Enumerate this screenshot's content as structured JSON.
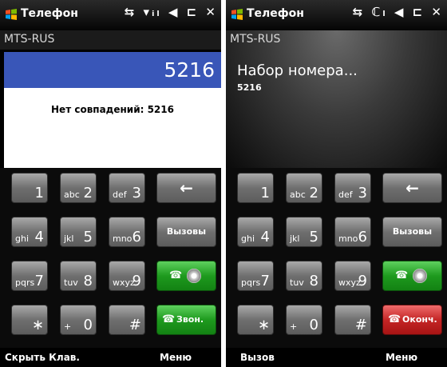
{
  "screen_left": {
    "status_title": "Телефон",
    "status_icons": "⇆ ▾ᵢₗ ◀ ⊏ ✕",
    "carrier": "MTS-RUS",
    "entered_number": "5216",
    "no_matches": "Нет совпадений: 5216",
    "keys": [
      {
        "letters": "",
        "digit": "1"
      },
      {
        "letters": "abc",
        "digit": "2"
      },
      {
        "letters": "def",
        "digit": "3"
      },
      {
        "letters": "ghi",
        "digit": "4"
      },
      {
        "letters": "jkl",
        "digit": "5"
      },
      {
        "letters": "mno",
        "digit": "6"
      },
      {
        "letters": "pqrs",
        "digit": "7"
      },
      {
        "letters": "tuv",
        "digit": "8"
      },
      {
        "letters": "wxyz",
        "digit": "9"
      },
      {
        "letters": "",
        "digit": "∗"
      },
      {
        "letters": "+",
        "digit": "0"
      },
      {
        "letters": "",
        "digit": "#"
      }
    ],
    "backspace_symbol": "←",
    "calls_label": "Вызовы",
    "call_label": "Звон.",
    "soft_left": "Скрыть Клав.",
    "soft_right": "Меню"
  },
  "screen_right": {
    "status_title": "Телефон",
    "status_icons": "⇆ ℂₗ ◀ ⊏ ✕",
    "carrier": "MTS-RUS",
    "dialing_text": "Набор номера...",
    "dialing_number": "5216",
    "keys": [
      {
        "letters": "",
        "digit": "1"
      },
      {
        "letters": "abc",
        "digit": "2"
      },
      {
        "letters": "def",
        "digit": "3"
      },
      {
        "letters": "ghi",
        "digit": "4"
      },
      {
        "letters": "jkl",
        "digit": "5"
      },
      {
        "letters": "mno",
        "digit": "6"
      },
      {
        "letters": "pqrs",
        "digit": "7"
      },
      {
        "letters": "tuv",
        "digit": "8"
      },
      {
        "letters": "wxyz",
        "digit": "9"
      },
      {
        "letters": "",
        "digit": "∗"
      },
      {
        "letters": "+",
        "digit": "0"
      },
      {
        "letters": "",
        "digit": "#"
      }
    ],
    "backspace_symbol": "←",
    "calls_label": "Вызовы",
    "end_label": "Оконч.",
    "soft_left": "Вызов",
    "soft_right": "Меню"
  },
  "colors": {
    "number_bar": "#3956b8",
    "call_green": "#1e9a1e",
    "end_red": "#c42626"
  }
}
